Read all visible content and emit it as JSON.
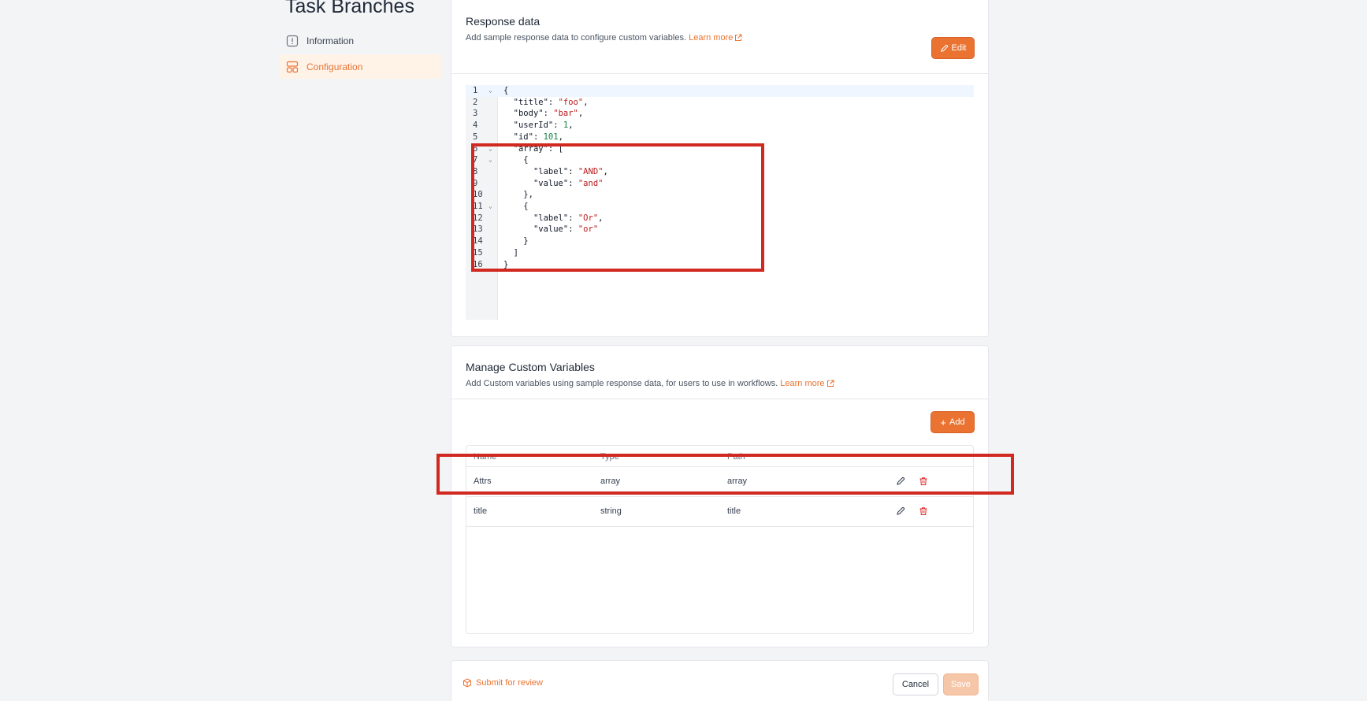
{
  "page": {
    "title": "Task Branches"
  },
  "sidebar": {
    "items": [
      {
        "label": "Information",
        "icon": "info-square-icon",
        "active": false
      },
      {
        "label": "Configuration",
        "icon": "layout-grid-icon",
        "active": true
      }
    ]
  },
  "response_data": {
    "title": "Response data",
    "subtitle": "Add sample response data to configure custom variables.",
    "learn_more": "Learn more",
    "edit_label": "Edit",
    "code_lines": [
      {
        "n": "1",
        "fold": true,
        "tokens": [
          [
            "p",
            "{"
          ]
        ]
      },
      {
        "n": "2",
        "fold": false,
        "tokens": [
          [
            "p",
            "  "
          ],
          [
            "k",
            "\"title\""
          ],
          [
            "p",
            ": "
          ],
          [
            "s",
            "\"foo\""
          ],
          [
            "p",
            ","
          ]
        ]
      },
      {
        "n": "3",
        "fold": false,
        "tokens": [
          [
            "p",
            "  "
          ],
          [
            "k",
            "\"body\""
          ],
          [
            "p",
            ": "
          ],
          [
            "s",
            "\"bar\""
          ],
          [
            "p",
            ","
          ]
        ]
      },
      {
        "n": "4",
        "fold": false,
        "tokens": [
          [
            "p",
            "  "
          ],
          [
            "k",
            "\"userId\""
          ],
          [
            "p",
            ": "
          ],
          [
            "n",
            "1"
          ],
          [
            "p",
            ","
          ]
        ]
      },
      {
        "n": "5",
        "fold": false,
        "tokens": [
          [
            "p",
            "  "
          ],
          [
            "k",
            "\"id\""
          ],
          [
            "p",
            ": "
          ],
          [
            "n",
            "101"
          ],
          [
            "p",
            ","
          ]
        ]
      },
      {
        "n": "6",
        "fold": true,
        "tokens": [
          [
            "p",
            "  "
          ],
          [
            "k",
            "\"array\""
          ],
          [
            "p",
            ": ["
          ]
        ]
      },
      {
        "n": "7",
        "fold": true,
        "tokens": [
          [
            "p",
            "    {"
          ]
        ]
      },
      {
        "n": "8",
        "fold": false,
        "tokens": [
          [
            "p",
            "      "
          ],
          [
            "k",
            "\"label\""
          ],
          [
            "p",
            ": "
          ],
          [
            "s",
            "\"AND\""
          ],
          [
            "p",
            ","
          ]
        ]
      },
      {
        "n": "9",
        "fold": false,
        "tokens": [
          [
            "p",
            "      "
          ],
          [
            "k",
            "\"value\""
          ],
          [
            "p",
            ": "
          ],
          [
            "s",
            "\"and\""
          ]
        ]
      },
      {
        "n": "10",
        "fold": false,
        "tokens": [
          [
            "p",
            "    },"
          ]
        ]
      },
      {
        "n": "11",
        "fold": true,
        "tokens": [
          [
            "p",
            "    {"
          ]
        ]
      },
      {
        "n": "12",
        "fold": false,
        "tokens": [
          [
            "p",
            "      "
          ],
          [
            "k",
            "\"label\""
          ],
          [
            "p",
            ": "
          ],
          [
            "s",
            "\"Or\""
          ],
          [
            "p",
            ","
          ]
        ]
      },
      {
        "n": "13",
        "fold": false,
        "tokens": [
          [
            "p",
            "      "
          ],
          [
            "k",
            "\"value\""
          ],
          [
            "p",
            ": "
          ],
          [
            "s",
            "\"or\""
          ]
        ]
      },
      {
        "n": "14",
        "fold": false,
        "tokens": [
          [
            "p",
            "    }"
          ]
        ]
      },
      {
        "n": "15",
        "fold": false,
        "tokens": [
          [
            "p",
            "  ]"
          ]
        ]
      },
      {
        "n": "16",
        "fold": false,
        "tokens": [
          [
            "p",
            "}"
          ]
        ]
      }
    ]
  },
  "custom_variables": {
    "title": "Manage Custom Variables",
    "subtitle": "Add Custom variables using sample response data, for users to use in workflows.",
    "learn_more": "Learn more",
    "add_label": "Add",
    "columns": [
      "Name",
      "Type",
      "Path"
    ],
    "rows": [
      {
        "name": "Attrs",
        "type": "array",
        "path": "array"
      },
      {
        "name": "title",
        "type": "string",
        "path": "title"
      }
    ]
  },
  "footer": {
    "submit_label": "Submit for review",
    "cancel_label": "Cancel",
    "save_label": "Save"
  },
  "colors": {
    "accent": "#ea7331",
    "highlight_box": "#d1281f",
    "delete": "#dc2626"
  }
}
